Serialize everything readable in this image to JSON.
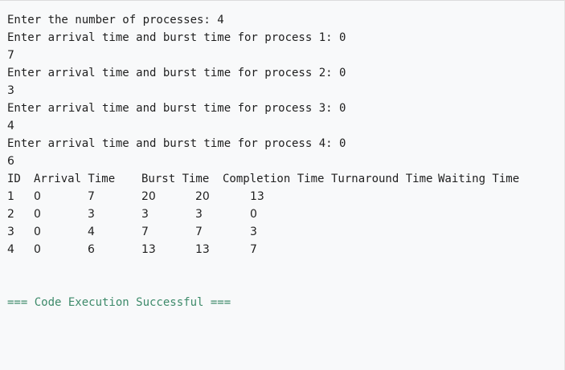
{
  "console": {
    "prompt_processes": "Enter the number of processes: 4",
    "inputs": [
      {
        "prompt": "Enter arrival time and burst time for process 1: 0",
        "value": "7"
      },
      {
        "prompt": "Enter arrival time and burst time for process 2: 0",
        "value": "3"
      },
      {
        "prompt": "Enter arrival time and burst time for process 3: 0",
        "value": "4"
      },
      {
        "prompt": "Enter arrival time and burst time for process 4: 0",
        "value": "6"
      }
    ],
    "table": {
      "headers": [
        "ID",
        "Arrival Time",
        "Burst Time",
        "Completion Time",
        "Turnaround Time",
        "Waiting Time"
      ],
      "rows": [
        [
          "1",
          "0",
          "7",
          "20",
          "20",
          "13"
        ],
        [
          "2",
          "0",
          "3",
          "3",
          "3",
          "0"
        ],
        [
          "3",
          "0",
          "4",
          "7",
          "7",
          "3"
        ],
        [
          "4",
          "0",
          "6",
          "13",
          "13",
          "7"
        ]
      ]
    },
    "status": "=== Code Execution Successful ==="
  }
}
